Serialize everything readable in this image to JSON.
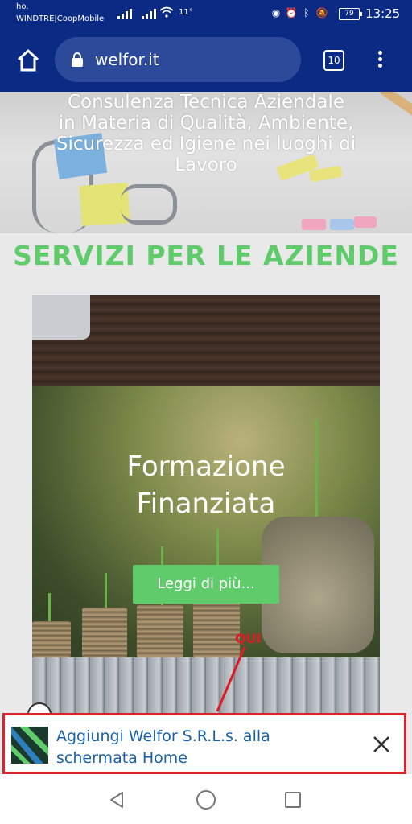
{
  "status_bar": {
    "carrier_line1": "ho.",
    "carrier_line2": "WINDTRE|CoopMobile",
    "temperature": "11°",
    "battery": "79",
    "time": "13:25"
  },
  "browser": {
    "url": "welfor.it",
    "tab_count": "10"
  },
  "hero": {
    "title_lines": [
      "Consulenza Tecnica Aziendale",
      "in Materia di Qualità, Ambiente,",
      "Sicurezza ed Igiene nei luoghi di",
      "Lavoro"
    ]
  },
  "services": {
    "title": "SERVIZI PER LE AZIENDE"
  },
  "card": {
    "title_lines": [
      "Formazione",
      "Finanziata"
    ],
    "button_label": "Leggi di più..."
  },
  "annotation": {
    "label": "QUI",
    "color": "#e01b24"
  },
  "add_to_home": {
    "text_line1": "Aggiungi Welfor S.R.L.s. alla",
    "text_line2": "schermata Home",
    "border_color": "#d7242e"
  },
  "colors": {
    "toolbar": "#0b2a84",
    "accent_green": "#5fcb6a",
    "link_blue": "#1a62a8"
  }
}
